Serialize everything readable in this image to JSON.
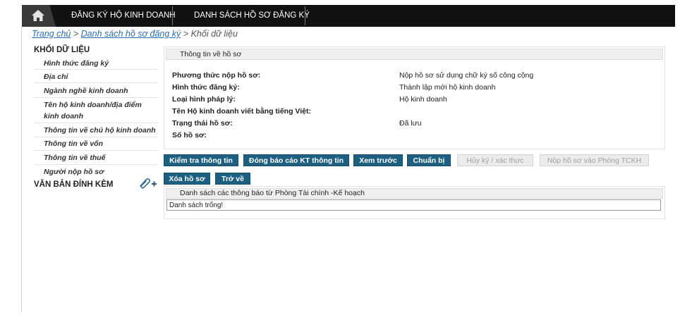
{
  "nav": {
    "items": [
      "ĐĂNG KÝ HỘ KINH DOANH",
      "DANH SÁCH HỒ SƠ ĐĂNG KÝ"
    ]
  },
  "breadcrumb": {
    "home": "Trang chủ",
    "sep1": ">",
    "list": "Danh sách hồ sơ đăng ký",
    "sep2": ">",
    "current": "Khối dữ liệu"
  },
  "sidebar": {
    "title": "KHỐI DỮ LIỆU",
    "items": [
      "Hình thức đăng ký",
      "Địa chỉ",
      "Ngành nghề kinh doanh",
      "Tên hộ kinh doanh/địa điểm kinh doanh",
      "Thông tin về chủ hộ kinh doanh",
      "Thông tin về vốn",
      "Thông tin về thuế",
      "Người nộp hồ sơ"
    ],
    "attachments_title": "VĂN BẢN ĐÍNH KÈM"
  },
  "profile": {
    "header": "Thông tin về hồ sơ",
    "rows": [
      {
        "label": "Phương thức nộp hồ sơ:",
        "value": "Nộp hồ sơ sử dụng chữ ký số công cộng"
      },
      {
        "label": "Hình thức đăng ký:",
        "value": "Thành lập mới hộ kinh doanh"
      },
      {
        "label": "Loại hình pháp lý:",
        "value": "Hộ kinh doanh"
      },
      {
        "label": "Tên Hộ kinh doanh viết bằng tiếng Việt:",
        "value": ""
      },
      {
        "label": "Trạng thái hồ sơ:",
        "value": "Đã lưu"
      },
      {
        "label": "Số hồ sơ:",
        "value": ""
      }
    ]
  },
  "actions": {
    "check": "Kiểm tra thông tin",
    "report": "Đóng báo cáo KT thông tin",
    "preview": "Xem trước",
    "prepare": "Chuẩn bị",
    "cancel_sign": "Hủy ký / xác thực",
    "submit": "Nộp hồ sơ vào Phòng TCKH",
    "delete": "Xóa hồ sơ",
    "back": "Trở về"
  },
  "notices": {
    "header": "Danh sách các thông báo từ Phòng Tài chính -Kế hoạch",
    "empty": "Danh sách trống!"
  },
  "colors": {
    "topbar": "#111111",
    "button": "#1d5f80",
    "link": "#2a6db5"
  },
  "icons": {
    "home": "home-icon",
    "attach": "paperclip-plus-icon"
  }
}
